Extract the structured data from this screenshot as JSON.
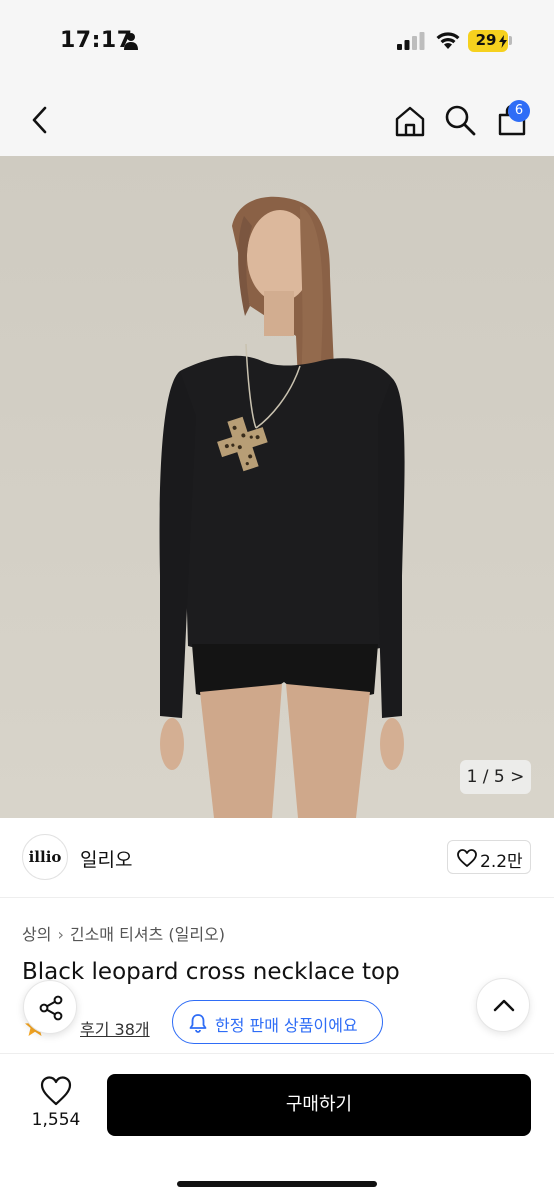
{
  "status_bar": {
    "time": "17:17",
    "battery": "29",
    "icons": [
      "person-icon",
      "signal-icon",
      "wifi-icon",
      "battery-icon"
    ]
  },
  "nav": {
    "icons": [
      "back-icon",
      "home-icon",
      "search-icon",
      "shopping-bag-icon"
    ],
    "cart_count": "6"
  },
  "gallery": {
    "counter": "1 / 5 >",
    "current": 1,
    "total": 5,
    "description_icon": "product-photo"
  },
  "brand": {
    "logo_text": "illio",
    "name": "일리오",
    "likes": "2.2만"
  },
  "breadcrumb": {
    "category": "상의",
    "subcategory": "긴소매 티셔츠 (일리오)"
  },
  "product": {
    "title": "Black leopard cross necklace top",
    "rating": "5",
    "reviews": "후기 38개",
    "limited_label": "한정 판매 상품이에요"
  },
  "bottom_bar": {
    "wishlist_count": "1,554",
    "buy_label": "구매하기"
  },
  "colors": {
    "accent": "#2f6df6",
    "battery": "#f6d11e",
    "buy_button": "#000000"
  }
}
